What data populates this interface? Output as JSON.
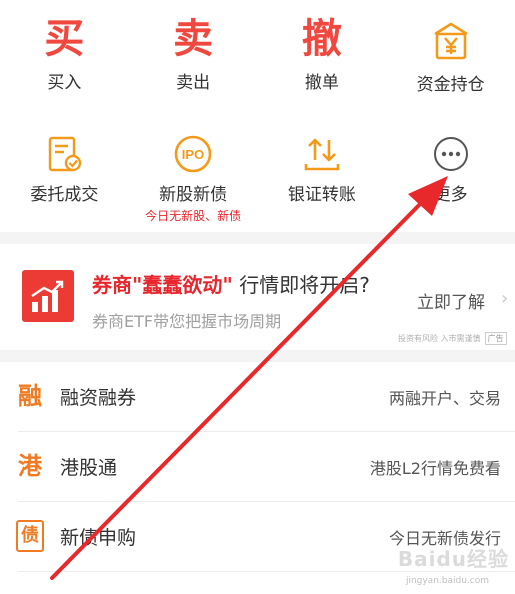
{
  "quick_actions": [
    {
      "char": "买",
      "label": "买入"
    },
    {
      "char": "卖",
      "label": "卖出"
    },
    {
      "char": "撤",
      "label": "撤单"
    },
    {
      "label": "资金持仓",
      "icon": "fund-position-icon"
    }
  ],
  "services": [
    {
      "label": "委托成交",
      "icon": "order-record-icon"
    },
    {
      "label": "新股新债",
      "icon": "ipo-icon",
      "icon_text": "IPO",
      "sub": "今日无新股、新债"
    },
    {
      "label": "银证转账",
      "icon": "transfer-icon"
    },
    {
      "label": "更多",
      "icon": "more-icon"
    }
  ],
  "banner": {
    "title_highlight": "券商\"蠢蠢欲动\"",
    "title_rest": "行情即将开启?",
    "desc": "券商ETF带您把握市场周期",
    "cta": "立即了解",
    "disclaimer": "投资有风险 入市需谨慎",
    "ad_label": "广告"
  },
  "list": [
    {
      "icon_char": "融",
      "label": "融资融券",
      "value": "两融开户、交易"
    },
    {
      "icon_char": "港",
      "label": "港股通",
      "value": "港股L2行情免费看"
    },
    {
      "icon_char": "债",
      "label": "新债申购",
      "value": "今日无新债发行"
    }
  ],
  "watermark": {
    "text": "Baidu经验",
    "url": "jingyan.baidu.com"
  },
  "colors": {
    "accent_red": "#f0483e",
    "accent_orange": "#f39a1a",
    "list_icon_orange": "#f07b22",
    "annotation_arrow": "#e8282a"
  }
}
